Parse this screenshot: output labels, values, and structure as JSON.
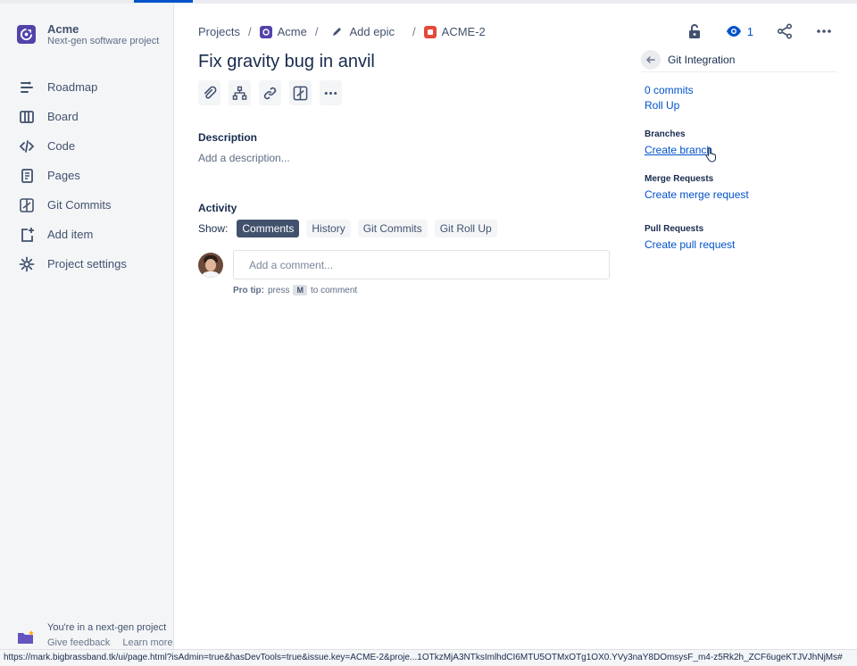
{
  "project": {
    "name": "Acme",
    "type": "Next-gen software project"
  },
  "sidebar": {
    "items": [
      {
        "label": "Roadmap",
        "icon": "roadmap-icon"
      },
      {
        "label": "Board",
        "icon": "board-icon"
      },
      {
        "label": "Code",
        "icon": "code-icon"
      },
      {
        "label": "Pages",
        "icon": "pages-icon"
      },
      {
        "label": "Git Commits",
        "icon": "git-commits-icon"
      },
      {
        "label": "Add item",
        "icon": "add-item-icon"
      },
      {
        "label": "Project settings",
        "icon": "gear-icon"
      }
    ],
    "footer": {
      "message": "You're in a next-gen project",
      "feedback": "Give feedback",
      "learn": "Learn more"
    }
  },
  "breadcrumbs": {
    "projects": "Projects",
    "project": "Acme",
    "epic": "Add epic",
    "issue_key": "ACME-2"
  },
  "header": {
    "watch_count": "1"
  },
  "issue": {
    "title": "Fix gravity bug in anvil",
    "description_heading": "Description",
    "description_placeholder": "Add a description..."
  },
  "activity": {
    "heading": "Activity",
    "show_label": "Show:",
    "filters": [
      "Comments",
      "History",
      "Git Commits",
      "Git Roll Up"
    ],
    "selected_filter": "Comments",
    "comment_placeholder": "Add a comment...",
    "protip_bold": "Pro tip:",
    "protip_press": "press",
    "protip_key": "M",
    "protip_rest": "to comment"
  },
  "git_panel": {
    "title": "Git Integration",
    "commits": "0 commits",
    "rollup": "Roll Up",
    "branches_heading": "Branches",
    "create_branch": "Create branch",
    "merge_heading": "Merge Requests",
    "create_merge": "Create merge request",
    "pull_heading": "Pull Requests",
    "create_pull": "Create pull request"
  },
  "statusbar": {
    "url": "https://mark.bigbrassband.tk/ui/page.html?isAdmin=true&hasDevTools=true&issue.key=ACME-2&proje...1OTkzMjA3NTksImlhdCI6MTU5OTMxOTg1OX0.YVy3naY8DOmsysF_m4-z5Rk2h_ZCF6ugeKTJVJhNjMs#"
  },
  "colors": {
    "accent": "#0052cc",
    "project_avatar": "#5243aa",
    "issue_type": "#e5493a"
  }
}
